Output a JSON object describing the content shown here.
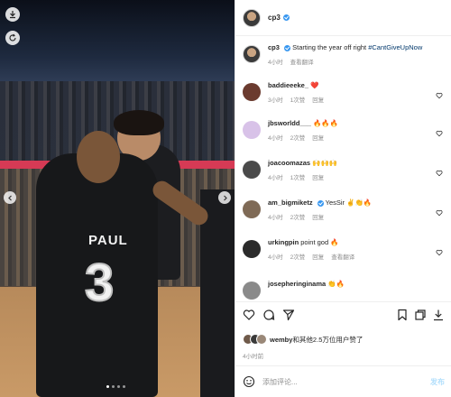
{
  "post": {
    "username": "cp3",
    "caption_user": "cp3",
    "caption_text": "Starting the year off right",
    "caption_tag": "#CantGiveUpNow",
    "caption_time": "4小时",
    "translate": "查看翻译",
    "jersey_name": "PAUL",
    "jersey_number": "3"
  },
  "comments": [
    {
      "user": "baddieeeke_",
      "text": "❤️",
      "time": "3小时",
      "likes": "1次赞",
      "reply": "回复",
      "avatar_color": "#6b3b2f"
    },
    {
      "user": "jbsworldd___",
      "text": "🔥🔥🔥",
      "time": "4小时",
      "likes": "2次赞",
      "reply": "回复",
      "avatar_color": "#d8c2e8"
    },
    {
      "user": "joacoomazas",
      "text": "🙌🙌🙌",
      "time": "4小时",
      "likes": "1次赞",
      "reply": "回复",
      "avatar_color": "#4a4a4a"
    },
    {
      "user": "am_bigmiketz",
      "text": "YesSir ✌️👏🔥",
      "time": "4小时",
      "likes": "2次赞",
      "reply": "回复",
      "avatar_color": "#7f6a56"
    },
    {
      "user": "urkingpin",
      "text": "point god 🔥",
      "time": "4小时",
      "likes": "2次赞",
      "reply": "回复",
      "translate": "查看翻译",
      "avatar_color": "#2b2b2b"
    },
    {
      "user": "josepheringinama",
      "text": "👏🔥",
      "time": "4小时",
      "likes": "",
      "reply": "",
      "avatar_color": "#8a8a8a"
    }
  ],
  "likes_summary": {
    "prefix_user": "wemby",
    "text": "和其他2.5万位用户赞了",
    "time": "4小时前"
  },
  "add_comment": {
    "placeholder": "添加评论...",
    "post_label": "发布"
  },
  "colors": {
    "accent": "#3897f0",
    "banner": "#d63a55",
    "heart": "#ed4956"
  }
}
